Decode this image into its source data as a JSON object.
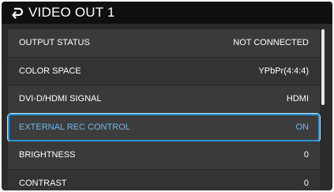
{
  "header": {
    "title": "VIDEO OUT 1",
    "back_icon": "return-arrow-icon"
  },
  "menu": {
    "items": [
      {
        "label": "OUTPUT STATUS",
        "value": "NOT CONNECTED",
        "selected": false
      },
      {
        "label": "COLOR SPACE",
        "value": "YPbPr(4:4:4)",
        "selected": false
      },
      {
        "label": "DVI-D/HDMI SIGNAL",
        "value": "HDMI",
        "selected": false
      },
      {
        "label": "EXTERNAL REC CONTROL",
        "value": "ON",
        "selected": true
      },
      {
        "label": "BRIGHTNESS",
        "value": "0",
        "selected": false
      },
      {
        "label": "CONTRAST",
        "value": "0",
        "selected": false
      }
    ]
  },
  "colors": {
    "header_bg": "#0f0f0f",
    "row_bg": "#3a3a3a",
    "selected_border": "#2a93d5",
    "selected_text": "#6fb8ea"
  }
}
